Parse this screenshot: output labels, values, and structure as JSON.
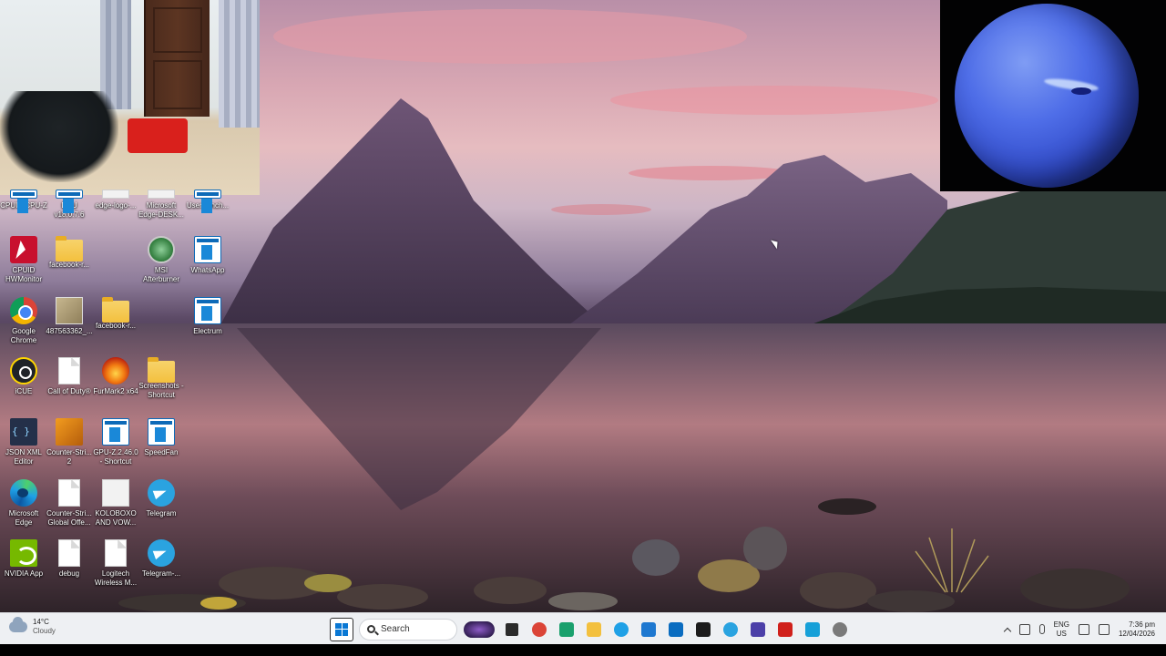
{
  "desktop": {
    "icons": [
      {
        "label": "CPUID CPU-Z",
        "icon": "cpuz-icon",
        "col": 0,
        "row": 0,
        "style": "i-strip i-app"
      },
      {
        "label": "DDU v18.0.7.6",
        "icon": "ddu-icon",
        "col": 1,
        "row": 0,
        "style": "i-strip i-app"
      },
      {
        "label": "edge-logo-...",
        "icon": "edge-logo-file-icon",
        "col": 2,
        "row": 0,
        "style": "i-strip i-white"
      },
      {
        "label": "Microsoft Edge-DESK...",
        "icon": "edge-desktop-file-icon",
        "col": 3,
        "row": 0,
        "style": "i-strip i-white"
      },
      {
        "label": "UserBench...",
        "icon": "userbenchmark-icon",
        "col": 4,
        "row": 0,
        "style": "i-strip i-app"
      },
      {
        "label": "CPUID HWMonitor",
        "icon": "hwmonitor-icon",
        "col": 0,
        "row": 1,
        "style": "i-cpuid"
      },
      {
        "label": "facebook-r...",
        "icon": "folder-icon",
        "col": 1,
        "row": 1,
        "style": "i-folder"
      },
      {
        "label": "MSI Afterburner",
        "icon": "msi-afterburner-icon",
        "col": 3,
        "row": 1,
        "style": "i-msi"
      },
      {
        "label": "WhatsApp",
        "icon": "whatsapp-icon",
        "col": 4,
        "row": 1,
        "style": "i-app"
      },
      {
        "label": "Google Chrome",
        "icon": "chrome-icon",
        "col": 0,
        "row": 2,
        "style": "i-chrome"
      },
      {
        "label": "487563362_...",
        "icon": "image-file-icon",
        "col": 1,
        "row": 2,
        "style": "i-img"
      },
      {
        "label": "facebook-r...",
        "icon": "folder-icon",
        "col": 2,
        "row": 2,
        "style": "i-folder"
      },
      {
        "label": "Electrum",
        "icon": "electrum-icon",
        "col": 4,
        "row": 2,
        "style": "i-app"
      },
      {
        "label": "iCUE",
        "icon": "icue-icon",
        "col": 0,
        "row": 3,
        "style": "i-icue"
      },
      {
        "label": "Call of Duty®",
        "icon": "document-icon",
        "col": 1,
        "row": 3,
        "style": "i-doc"
      },
      {
        "label": "FurMark2 x64",
        "icon": "furmark-icon",
        "col": 2,
        "row": 3,
        "style": "i-furmark"
      },
      {
        "label": "Screenshots - Shortcut",
        "icon": "folder-icon",
        "col": 3,
        "row": 3,
        "style": "i-folder"
      },
      {
        "label": "JSON XML Editor",
        "icon": "json-editor-icon",
        "col": 0,
        "row": 4,
        "style": "i-json"
      },
      {
        "label": "Counter-Stri... 2",
        "icon": "counter-strike-icon",
        "col": 1,
        "row": 4,
        "style": "i-cs"
      },
      {
        "label": "GPU-Z.2.46.0 - Shortcut",
        "icon": "gpuz-icon",
        "col": 2,
        "row": 4,
        "style": "i-app"
      },
      {
        "label": "SpeedFan",
        "icon": "speedfan-icon",
        "col": 3,
        "row": 4,
        "style": "i-app"
      },
      {
        "label": "Microsoft Edge",
        "icon": "edge-icon",
        "col": 0,
        "row": 5,
        "style": "i-edge"
      },
      {
        "label": "Counter-Stri... Global Offe...",
        "icon": "document-icon",
        "col": 1,
        "row": 5,
        "style": "i-doc"
      },
      {
        "label": "KOLOBOXO AND VOW...",
        "icon": "image-file-icon",
        "col": 2,
        "row": 5,
        "style": "i-white"
      },
      {
        "label": "Telegram",
        "icon": "telegram-icon",
        "col": 3,
        "row": 5,
        "style": "i-telegram"
      },
      {
        "label": "NVIDIA App",
        "icon": "nvidia-icon",
        "col": 0,
        "row": 6,
        "style": "i-nvidia"
      },
      {
        "label": "debug",
        "icon": "document-icon",
        "col": 1,
        "row": 6,
        "style": "i-doc"
      },
      {
        "label": "Logitech Wireless M...",
        "icon": "document-icon",
        "col": 2,
        "row": 6,
        "style": "i-doc"
      },
      {
        "label": "Telegram-...",
        "icon": "telegram-icon",
        "col": 3,
        "row": 6,
        "style": "i-telegram"
      }
    ]
  },
  "taskbar": {
    "weather": {
      "temp": "14°C",
      "condition": "Cloudy"
    },
    "search_label": "Search",
    "pinned": [
      {
        "name": "widgets-icon",
        "kind": "pill"
      },
      {
        "name": "task-view-icon",
        "kind": "tv"
      },
      {
        "name": "chrome-taskbar-icon",
        "kind": "dot",
        "color": "#db4437"
      },
      {
        "name": "teams-icon",
        "kind": "sq",
        "color": "#1aa06d"
      },
      {
        "name": "file-explorer-icon",
        "kind": "sq",
        "color": "#f3c03e"
      },
      {
        "name": "edge-taskbar-icon",
        "kind": "dot",
        "color": "#1fa0e6"
      },
      {
        "name": "outlook-icon",
        "kind": "sq",
        "color": "#1e78d0"
      },
      {
        "name": "calculator-icon",
        "kind": "sq",
        "color": "#0a6cc0"
      },
      {
        "name": "terminal-icon",
        "kind": "sq",
        "color": "#1c1c1c"
      },
      {
        "name": "whatsapp-taskbar-icon",
        "kind": "dot",
        "color": "#2aa3e0"
      },
      {
        "name": "settings-app-icon",
        "kind": "sq",
        "color": "#4b3fa8"
      },
      {
        "name": "acrobat-icon",
        "kind": "sq",
        "color": "#d0201b"
      },
      {
        "name": "photos-icon",
        "kind": "sq",
        "color": "#17a0d8"
      },
      {
        "name": "gear-icon",
        "kind": "dot",
        "color": "#7a7a7a"
      }
    ],
    "tray": {
      "lang_top": "ENG",
      "lang_bottom": "US",
      "time": "7:36 pm",
      "date": "12/04/2026"
    }
  }
}
